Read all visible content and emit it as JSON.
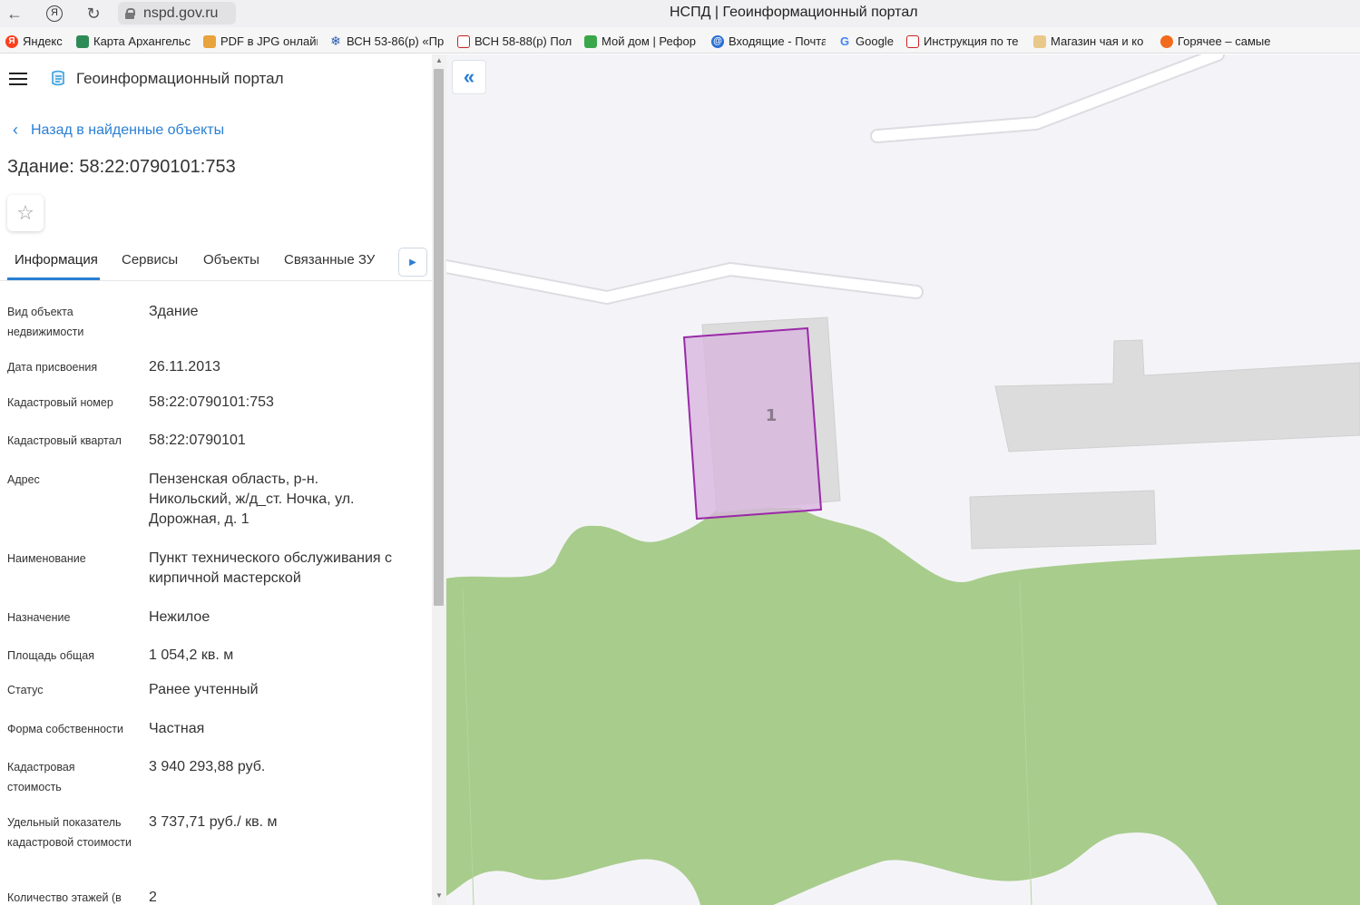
{
  "browser": {
    "url": "nspd.gov.ru",
    "page_title": "НСПД | Геоинформационный портал",
    "bookmarks": [
      {
        "label": "Яндекс",
        "icon": "yandex-icon"
      },
      {
        "label": "Карта Архангельс",
        "icon": "map-icon"
      },
      {
        "label": "PDF в JPG онлайн",
        "icon": "pdf-icon"
      },
      {
        "label": "ВСН 53-86(р) «Пр",
        "icon": "snowflake-icon"
      },
      {
        "label": "ВСН 58-88(р) Пол",
        "icon": "doc-icon"
      },
      {
        "label": "Мой дом | Рефор",
        "icon": "grid-icon"
      },
      {
        "label": "Входящие - Почта",
        "icon": "mail-icon"
      },
      {
        "label": "Google",
        "icon": "google-icon"
      },
      {
        "label": "Инструкция по те",
        "icon": "doc-icon"
      },
      {
        "label": "Магазин чая и ко",
        "icon": "tea-icon"
      },
      {
        "label": "Горячее – самые",
        "icon": "fire-icon"
      }
    ]
  },
  "app": {
    "title": "Геоинформационный портал",
    "back_label": "Назад в найденные объекты",
    "object_title": "Здание: 58:22:0790101:753"
  },
  "tabs": [
    "Информация",
    "Сервисы",
    "Объекты",
    "Связанные ЗУ"
  ],
  "properties": [
    {
      "label": "Вид объекта недвижимости",
      "value": "Здание"
    },
    {
      "label": "Дата присвоения",
      "value": "26.11.2013"
    },
    {
      "label": "Кадастровый номер",
      "value": "58:22:0790101:753"
    },
    {
      "label": "Кадастровый квартал",
      "value": "58:22:0790101"
    },
    {
      "label": "Адрес",
      "value": "Пензенская область, р-н. Никольский, ж/д_ст. Ночка, ул. Дорожная, д. 1"
    },
    {
      "label": "Наименование",
      "value": "Пункт технического обслуживания с кирпичной мастерской"
    },
    {
      "label": "Назначение",
      "value": "Нежилое"
    },
    {
      "label": "Площадь общая",
      "value": "1 054,2 кв. м"
    },
    {
      "label": "Статус",
      "value": "Ранее учтенный"
    },
    {
      "label": "Форма собственности",
      "value": "Частная"
    },
    {
      "label": "Кадастровая стоимость",
      "value": "3 940 293,88 руб."
    },
    {
      "label": "Удельный показатель кадастровой стоимости",
      "value": "3 737,71 руб./ кв. м"
    },
    {
      "label": "Количество этажей (в",
      "value": "2"
    }
  ],
  "map": {
    "building_label": "1",
    "colors": {
      "background": "#f4f4f8",
      "forest": "#a8cc8c",
      "building": "#dcdcdc",
      "selection": "#d8b6de",
      "selection_border": "#9a2aa8"
    }
  }
}
